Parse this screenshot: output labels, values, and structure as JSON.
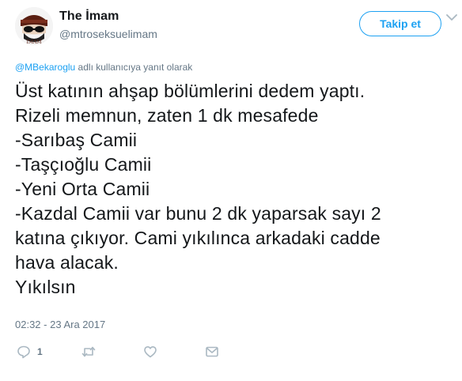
{
  "author": {
    "display_name": "The İmam",
    "handle": "@mtroseksuelimam",
    "avatar_caption": "İMAM"
  },
  "follow_button": {
    "label": "Takip et"
  },
  "reply_context": {
    "mention": "@MBekaroglu",
    "suffix": " adlı kullanıcıya yanıt olarak"
  },
  "tweet": {
    "lines": [
      "Üst katının ahşap bölümlerini dedem yaptı.",
      "Rizeli memnun, zaten 1 dk mesafede",
      "-Sarıbaş Camii",
      "-Taşçıoğlu Camii",
      "-Yeni Orta Camii",
      "-Kazdal Camii var bunu 2 dk yaparsak sayı 2",
      "katına çıkıyor. Cami yıkılınca arkadaki cadde",
      "hava alacak.",
      "Yıkılsın"
    ],
    "timestamp": "02:32 - 23 Ara 2017"
  },
  "actions": {
    "reply_count": "1",
    "icons": [
      "reply-icon",
      "retweet-icon",
      "like-icon",
      "direct-message-icon"
    ]
  },
  "colors": {
    "accent": "#1da1f2",
    "text": "#14171a",
    "secondary": "#657786",
    "icon": "#aab8c2"
  }
}
